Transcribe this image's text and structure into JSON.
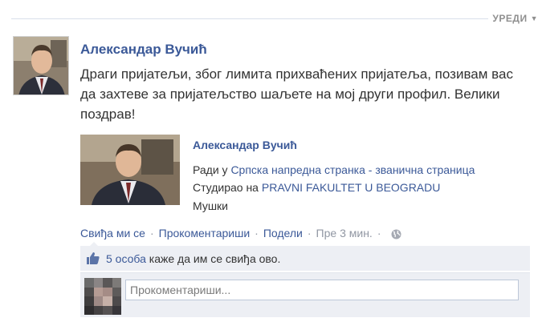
{
  "header": {
    "edit_label": "УРЕДИ"
  },
  "post": {
    "author": "Александар Вучић",
    "text": "Драги пријатељи, због лимита прихваћених пријатеља, позивам вас да захтеве за пријатељство шаљете на мој други профил. Велики поздрав!"
  },
  "shared_profile": {
    "name": "Александар Вучић",
    "works_prefix": "Ради у",
    "works_link": "Српска напредна странка - званична страница",
    "studied_prefix": "Студирао на",
    "studied_link": "PRAVNI FAKULTET U BEOGRADU",
    "gender": "Мушки"
  },
  "actions": {
    "like": "Свиђа ми се",
    "comment": "Прокоментариши",
    "share": "Подели",
    "separator": "·",
    "time": "Пре 3 мин.",
    "privacy_icon": "globe-icon"
  },
  "likes": {
    "count_text": "5 особа",
    "rest_text": "каже да им се свиђа ово."
  },
  "comment": {
    "placeholder": "Прокоментариши..."
  },
  "colors": {
    "link": "#3b5998",
    "panel": "#edeff4",
    "muted": "#9197a3"
  }
}
